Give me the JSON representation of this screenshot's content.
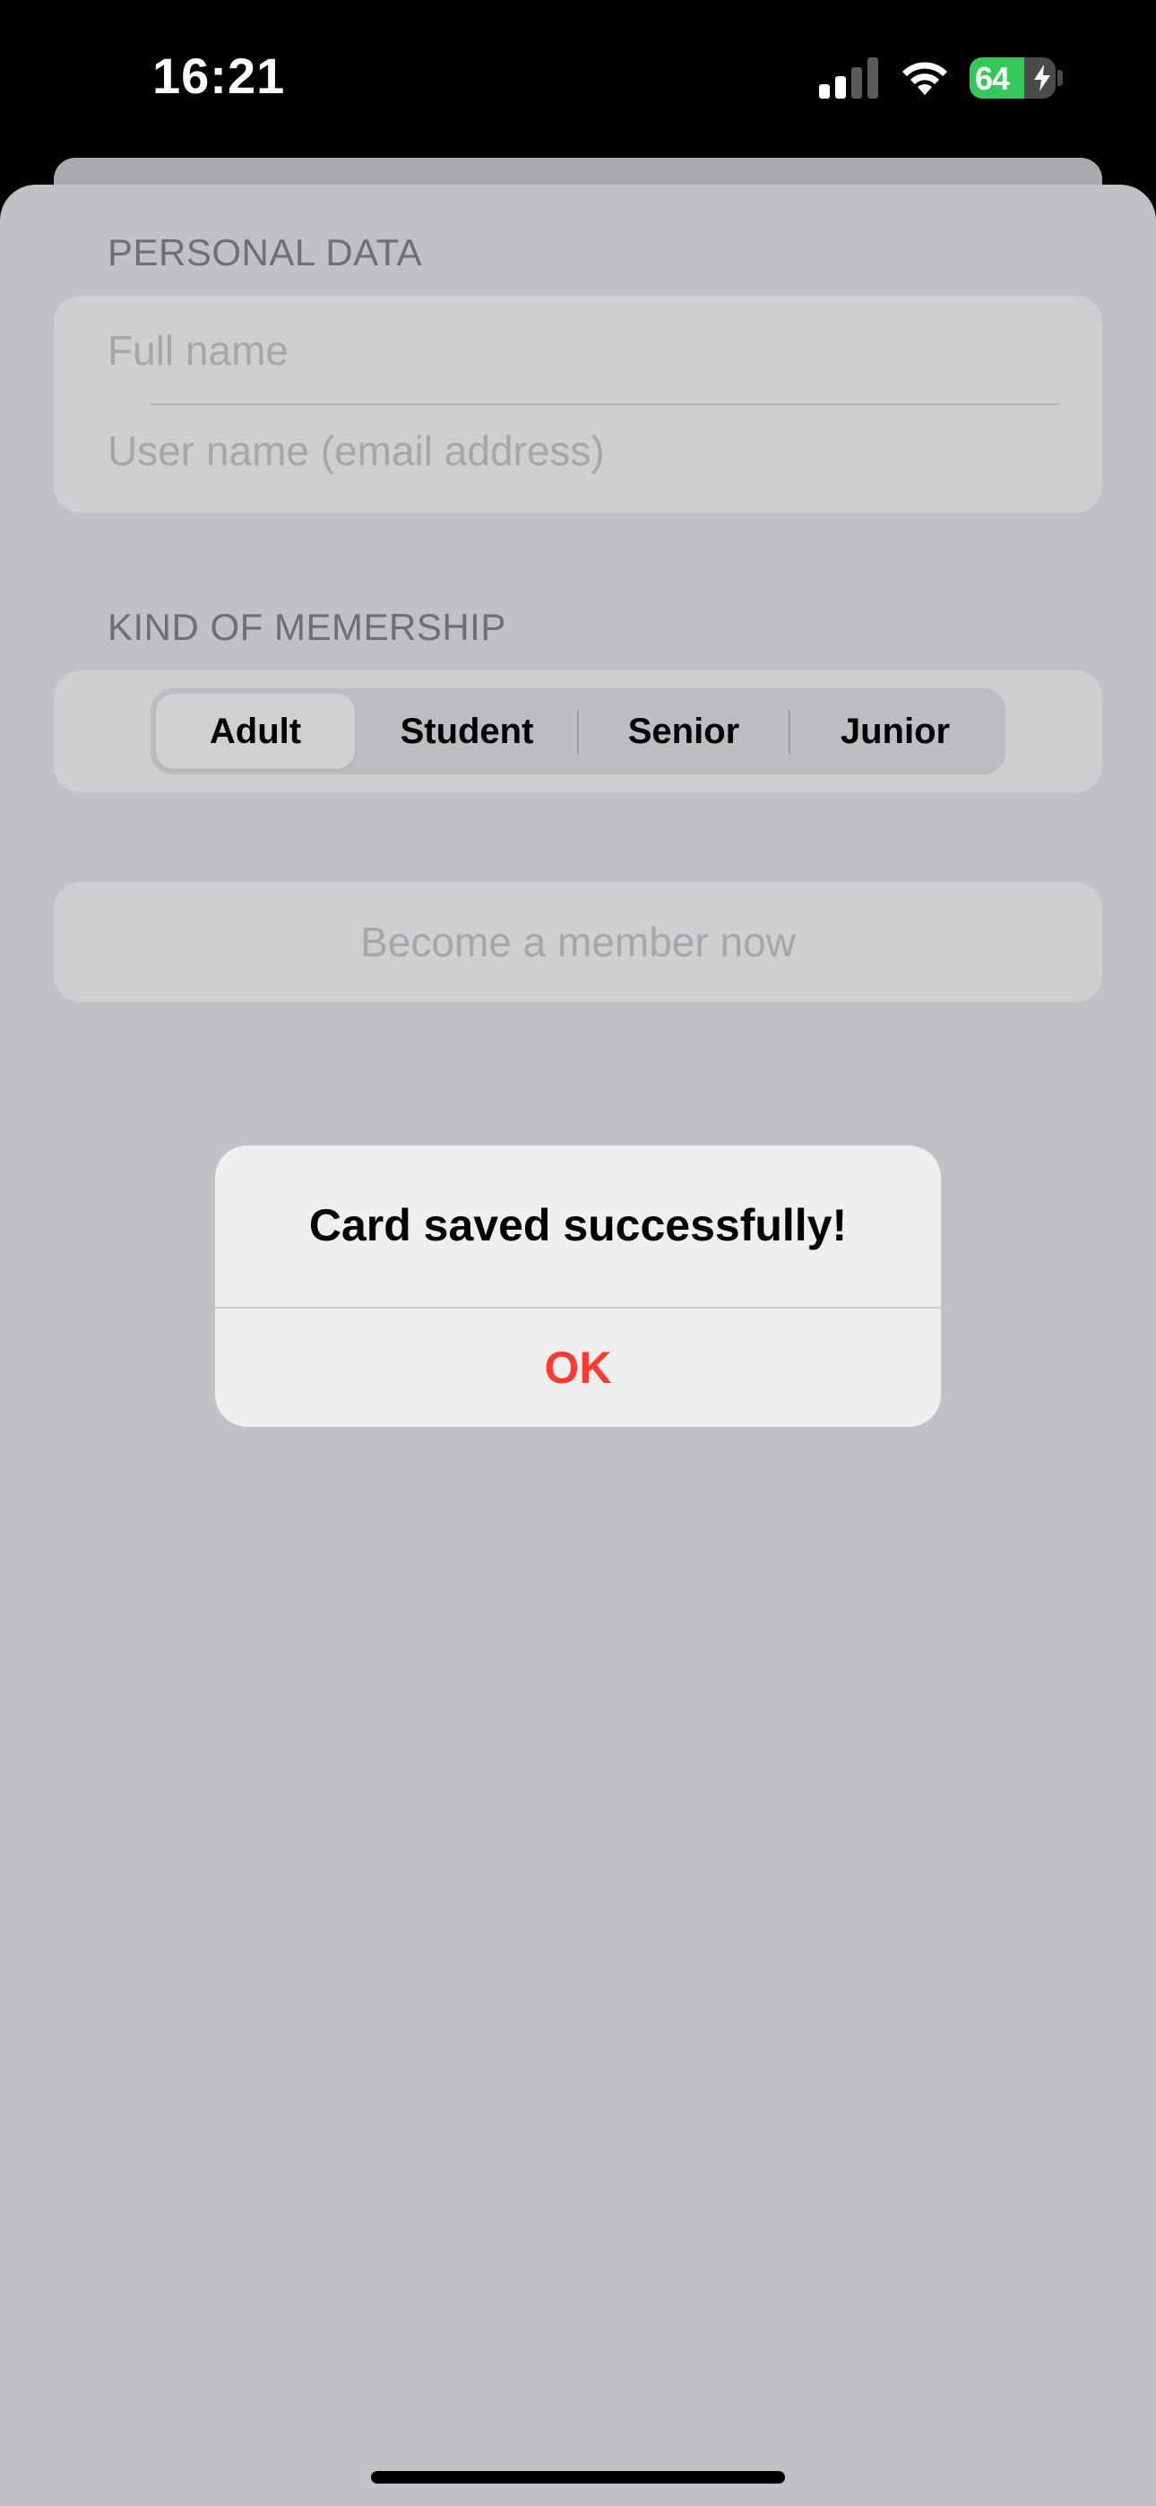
{
  "status_bar": {
    "time": "16:21",
    "battery_text": "64",
    "battery_level": 0.64,
    "signal_icon": "cellular-signal-icon",
    "wifi_icon": "wifi-icon",
    "battery_icon": "battery-charging-icon"
  },
  "form": {
    "personal_section_header": "PERSONAL DATA",
    "full_name_placeholder": "Full name",
    "username_placeholder": "User name (email address)",
    "membership_section_header": "KIND OF MEMERSHIP",
    "membership_options": [
      "Adult",
      "Student",
      "Senior",
      "Junior"
    ],
    "membership_selected": "Adult",
    "submit_label": "Become a member now"
  },
  "alert": {
    "title": "Card saved successfully!",
    "ok_label": "OK"
  },
  "colors": {
    "accent_destructive": "#ff3b30",
    "battery_green": "#35c759",
    "dimmed_background": "#c1c0c5",
    "alert_background": "#efeff1"
  }
}
